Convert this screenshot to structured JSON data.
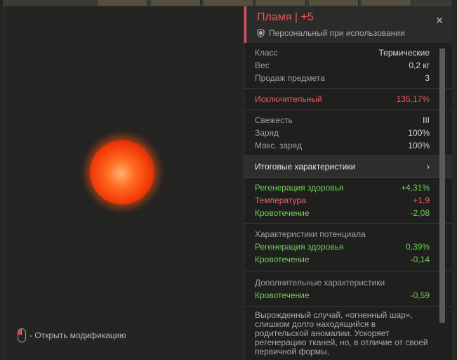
{
  "item": {
    "title": "Пламя | +5",
    "binding": "Персональный при использовании"
  },
  "basic": [
    {
      "label": "Класс",
      "value": "Термические"
    },
    {
      "label": "Вес",
      "value": "0,2 кг"
    },
    {
      "label": "Продаж предмета",
      "value": "3"
    }
  ],
  "rarity": {
    "label": "Исключительный",
    "value": "135,17%"
  },
  "condition": [
    {
      "label": "Свежесть",
      "value": "III"
    },
    {
      "label": "Заряд",
      "value": "100%"
    },
    {
      "label": "Макс. заряд",
      "value": "100%"
    }
  ],
  "summary_label": "Итоговые характеристики",
  "summary_arrow": "›",
  "final_stats": [
    {
      "label": "Регенерация здоровья",
      "value": "+4,31%"
    },
    {
      "label": "Температура",
      "value": "+1,9"
    },
    {
      "label": "Кровотечение",
      "value": "-2,08"
    }
  ],
  "potential": {
    "title": "Характеристики потенциала",
    "stats": [
      {
        "label": "Регенерация здоровья",
        "value": "0,39%"
      },
      {
        "label": "Кровотечение",
        "value": "-0,14"
      }
    ]
  },
  "additional": {
    "title": "Дополнительные характеристики",
    "stats": [
      {
        "label": "Кровотечение",
        "value": "-0,59"
      }
    ]
  },
  "description": "Вырожденный случай, «огненный шар», слишком долго находящийся в родительской аномалии. Ускоряет регенерацию тканей, но, в отличие от своей первичной формы,",
  "hint": "- Открыть модификацию",
  "close_glyph": "×",
  "colors": {
    "accent": "#e4505a",
    "positive": "#6fcf55",
    "negative": "#e26b6b"
  }
}
